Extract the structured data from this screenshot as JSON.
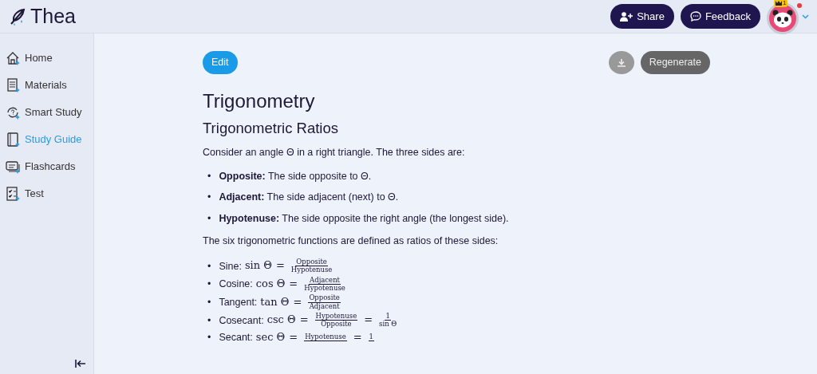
{
  "brand": {
    "name": "Thea"
  },
  "header": {
    "buttons": [
      {
        "kind": "share",
        "label": "Share"
      },
      {
        "kind": "feedback",
        "label": "Feedback"
      }
    ],
    "avatar": {
      "badge": "1",
      "notification": true
    }
  },
  "sidebar": {
    "items": [
      {
        "kind": "home",
        "label": "Home",
        "selected": false
      },
      {
        "kind": "materials",
        "label": "Materials",
        "selected": false
      },
      {
        "kind": "smart",
        "label": "Smart Study",
        "selected": false
      },
      {
        "kind": "guide",
        "label": "Study Guide",
        "selected": true
      },
      {
        "kind": "flashcards",
        "label": "Flashcards",
        "selected": false
      },
      {
        "kind": "test",
        "label": "Test",
        "selected": false
      }
    ]
  },
  "toolbar": {
    "edit": "Edit",
    "regenerate": "Regenerate"
  },
  "document": {
    "title": "Trigonometry",
    "section": "Trigonometric Ratios",
    "intro": "Consider an angle Θ in a right triangle. The three sides are:",
    "sides": [
      {
        "marker": "•",
        "term": "Opposite:",
        "text": "The side opposite to Θ."
      },
      {
        "marker": "•",
        "term": "Adjacent:",
        "text": "The side adjacent (next) to Θ."
      },
      {
        "marker": "•",
        "term": "Hypotenuse:",
        "text": "The side opposite the right angle (the longest side)."
      }
    ],
    "functions_intro": "The six trigonometric functions are defined as ratios of these sides:",
    "functions": [
      {
        "marker": "•",
        "label": "Sine:",
        "func": "sin Θ",
        "fractions": [
          {
            "op": "=",
            "num": "Opposite",
            "den": "Hypotenuse"
          }
        ]
      },
      {
        "marker": "•",
        "label": "Cosine:",
        "func": "cos Θ",
        "fractions": [
          {
            "op": "=",
            "num": "Adjacent",
            "den": "Hypotenuse"
          }
        ]
      },
      {
        "marker": "•",
        "label": "Tangent:",
        "func": "tan Θ",
        "fractions": [
          {
            "op": "=",
            "num": "Opposite",
            "den": "Adjacent"
          }
        ]
      },
      {
        "marker": "•",
        "label": "Cosecant:",
        "func": "csc Θ",
        "fractions": [
          {
            "op": "=",
            "num": "Hypotenuse",
            "den": "Opposite"
          },
          {
            "op": "=",
            "num": "1",
            "den": "sin Θ"
          }
        ]
      },
      {
        "marker": "•",
        "label": "Secant:",
        "func": "sec Θ",
        "fractions": [
          {
            "op": "=",
            "num": "Hypotenuse"
          },
          {
            "op": "=",
            "num": "1"
          }
        ]
      }
    ]
  }
}
